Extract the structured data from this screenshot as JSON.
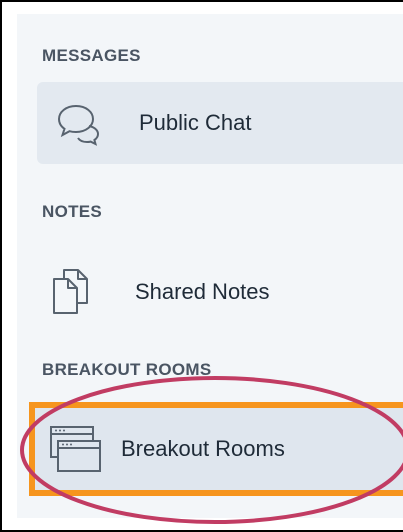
{
  "sections": {
    "messages": {
      "title": "MESSAGES",
      "item": {
        "label": "Public Chat",
        "icon": "chat-bubbles-icon"
      }
    },
    "notes": {
      "title": "NOTES",
      "item": {
        "label": "Shared Notes",
        "icon": "documents-icon"
      }
    },
    "breakout": {
      "title": "BREAKOUT ROOMS",
      "item": {
        "label": "Breakout Rooms",
        "icon": "windows-icon"
      }
    }
  },
  "colors": {
    "highlight_border": "#f6951e",
    "annotation_circle": "#c13c63",
    "panel_bg": "#f3f6f9",
    "active_item_bg": "#e3e9f0",
    "section_title": "#4a5563",
    "item_text": "#1f2b38"
  }
}
